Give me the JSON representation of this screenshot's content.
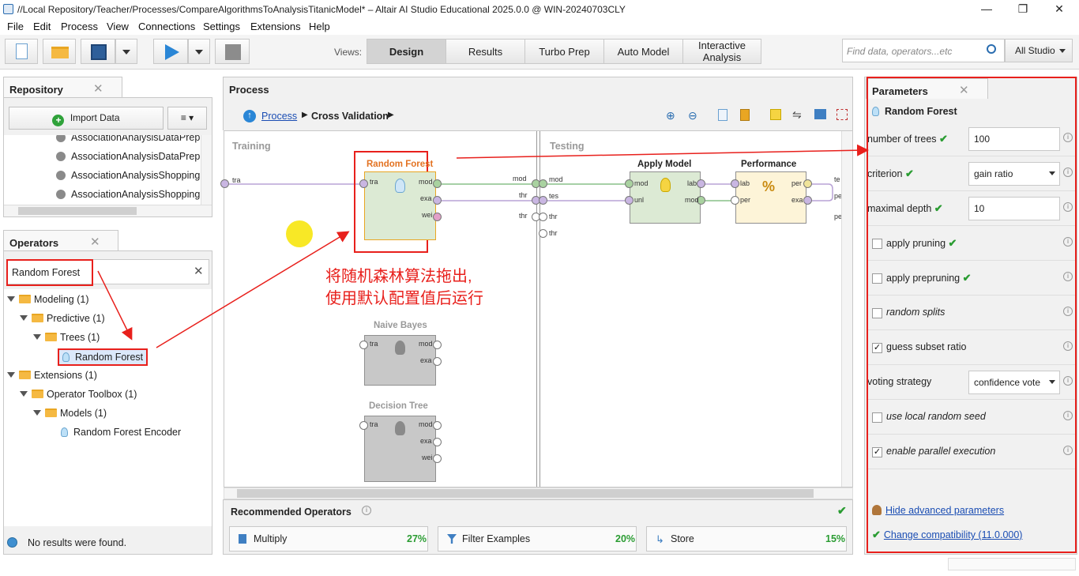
{
  "window": {
    "title": "//Local Repository/Teacher/Processes/CompareAlgorithmsToAnalysisTitanicModel* – Altair AI Studio Educational 2025.0.0 @ WIN-20240703CLY",
    "min": "—",
    "max": "❐",
    "close": "✕"
  },
  "menu": [
    "File",
    "Edit",
    "Process",
    "View",
    "Connections",
    "Settings",
    "Extensions",
    "Help"
  ],
  "toolbar": {
    "views_label": "Views:",
    "views": [
      "Design",
      "Results",
      "Turbo Prep",
      "Auto Model",
      "Interactive\nAnalysis"
    ],
    "search_placeholder": "Find data, operators...etc",
    "scope": "All Studio"
  },
  "repository": {
    "tab": "Repository",
    "import_button": "Import Data",
    "items": [
      "AssociationAnalysisDataPrep",
      "AssociationAnalysisDataPrep",
      "AssociationAnalysisShopping",
      "AssociationAnalysisShopping"
    ]
  },
  "operators": {
    "tab": "Operators",
    "search_value": "Random Forest",
    "tree": {
      "modeling": "Modeling (1)",
      "predictive": "Predictive (1)",
      "trees": "Trees (1)",
      "random_forest": "Random Forest",
      "extensions": "Extensions (1)",
      "toolbox": "Operator Toolbox (1)",
      "models": "Models (1)",
      "rf_encoder": "Random Forest Encoder"
    },
    "status": "No results were found."
  },
  "process": {
    "tab": "Process",
    "breadcrumb_root": "Process",
    "breadcrumb_current": "Cross Validation",
    "training_label": "Training",
    "testing_label": "Testing",
    "random_forest": {
      "name": "Random Forest",
      "in": "tra",
      "out1": "mod",
      "out2": "exa",
      "out3": "wei"
    },
    "apply_model": {
      "name": "Apply Model",
      "in1": "mod",
      "in2": "unl",
      "out1": "lab",
      "out2": "mod"
    },
    "performance": {
      "name": "Performance",
      "in1": "lab",
      "in2": "per",
      "out1": "per",
      "out2": "exa"
    },
    "naive_bayes": {
      "name": "Naive Bayes",
      "in": "tra",
      "out1": "mod",
      "out2": "exa"
    },
    "decision_tree": {
      "name": "Decision Tree",
      "in": "tra",
      "out1": "mod",
      "out2": "exa",
      "out3": "wei"
    },
    "left_port": "tra",
    "mid_out": [
      "mod",
      "thr"
    ],
    "mid_in": [
      "mod",
      "tes",
      "thr",
      "thr"
    ],
    "mid_out_thr": "thr",
    "right_ports": [
      "te",
      "pe",
      "pe"
    ],
    "annotation_line1": "将随机森林算法拖出,",
    "annotation_line2": "使用默认配置值后运行"
  },
  "recommended": {
    "title": "Recommended Operators",
    "items": [
      {
        "name": "Multiply",
        "pct": "27%"
      },
      {
        "name": "Filter Examples",
        "pct": "20%"
      },
      {
        "name": "Store",
        "pct": "15%"
      }
    ]
  },
  "parameters": {
    "tab": "Parameters",
    "operator": "Random Forest",
    "rows": [
      {
        "label": "number of trees",
        "value": "100"
      },
      {
        "label": "criterion",
        "value": "gain ratio"
      },
      {
        "label": "maximal depth",
        "value": "10"
      },
      {
        "label": "apply pruning",
        "checked": false
      },
      {
        "label": "apply prepruning",
        "checked": false
      },
      {
        "label": "random splits",
        "checked": false
      },
      {
        "label": "guess subset ratio",
        "checked": true
      },
      {
        "label": "voting strategy",
        "value": "confidence vote"
      },
      {
        "label": "use local random seed",
        "checked": false
      },
      {
        "label": "enable parallel execution",
        "checked": true
      }
    ],
    "hide_advanced": "Hide advanced parameters",
    "change_compat": "Change compatibility (11.0.000)"
  }
}
